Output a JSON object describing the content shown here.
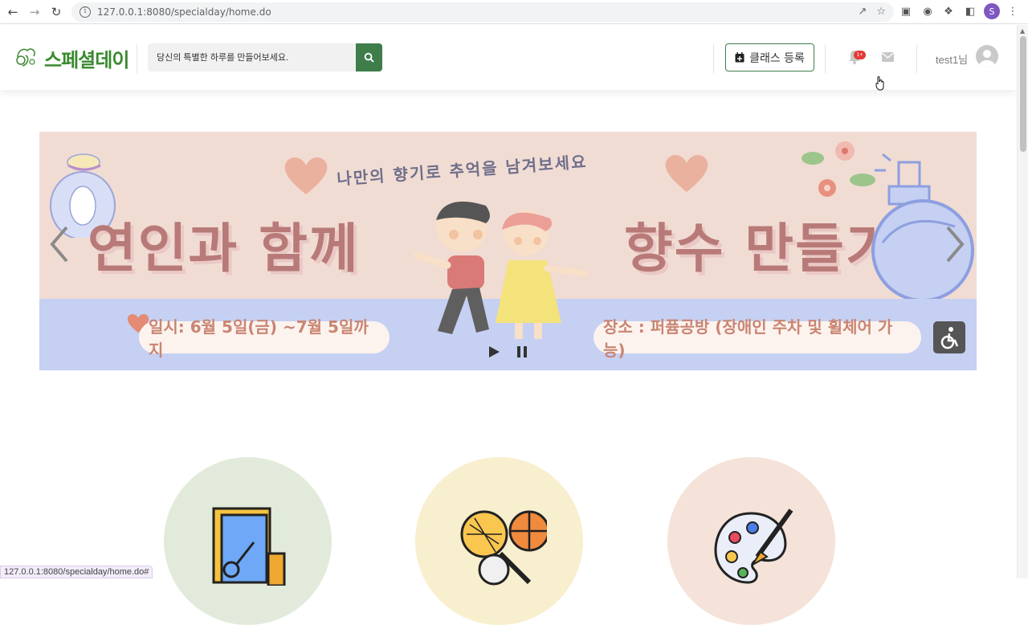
{
  "browser": {
    "url": "127.0.0.1:8080/specialday/home.do",
    "profile_initial": "S",
    "status_url": "127.0.0.1:8080/specialday/home.do#"
  },
  "header": {
    "logo_text": "스페셜데이",
    "search_placeholder": "당신의 특별한 하루를 만들어보세요.",
    "class_button_label": "클래스 등록",
    "notification_badge": "1+",
    "user_label": "test1님"
  },
  "banner": {
    "subtitle": "나만의 향기로 추억을 남겨보세요",
    "title_left": "연인과 함께",
    "title_right": "향수 만들기",
    "date_text": "일시: 6월 5일(금) ~7월 5일까지",
    "place_text": "장소 : 퍼퓸공방 (장애인 주차 및 휠체어 가능)"
  },
  "colors": {
    "brand_green": "#3f7d4b",
    "logo_green": "#3a8a2f",
    "banner_pink": "#f1dcd3",
    "banner_blue": "#c5d0f2",
    "title_rose": "#b87a78"
  },
  "categories": [
    {
      "icon": "craft-tools-icon",
      "color": "#e2ebdb"
    },
    {
      "icon": "sports-icon",
      "color": "#f8efce"
    },
    {
      "icon": "paint-palette-icon",
      "color": "#f5e3d9"
    }
  ]
}
